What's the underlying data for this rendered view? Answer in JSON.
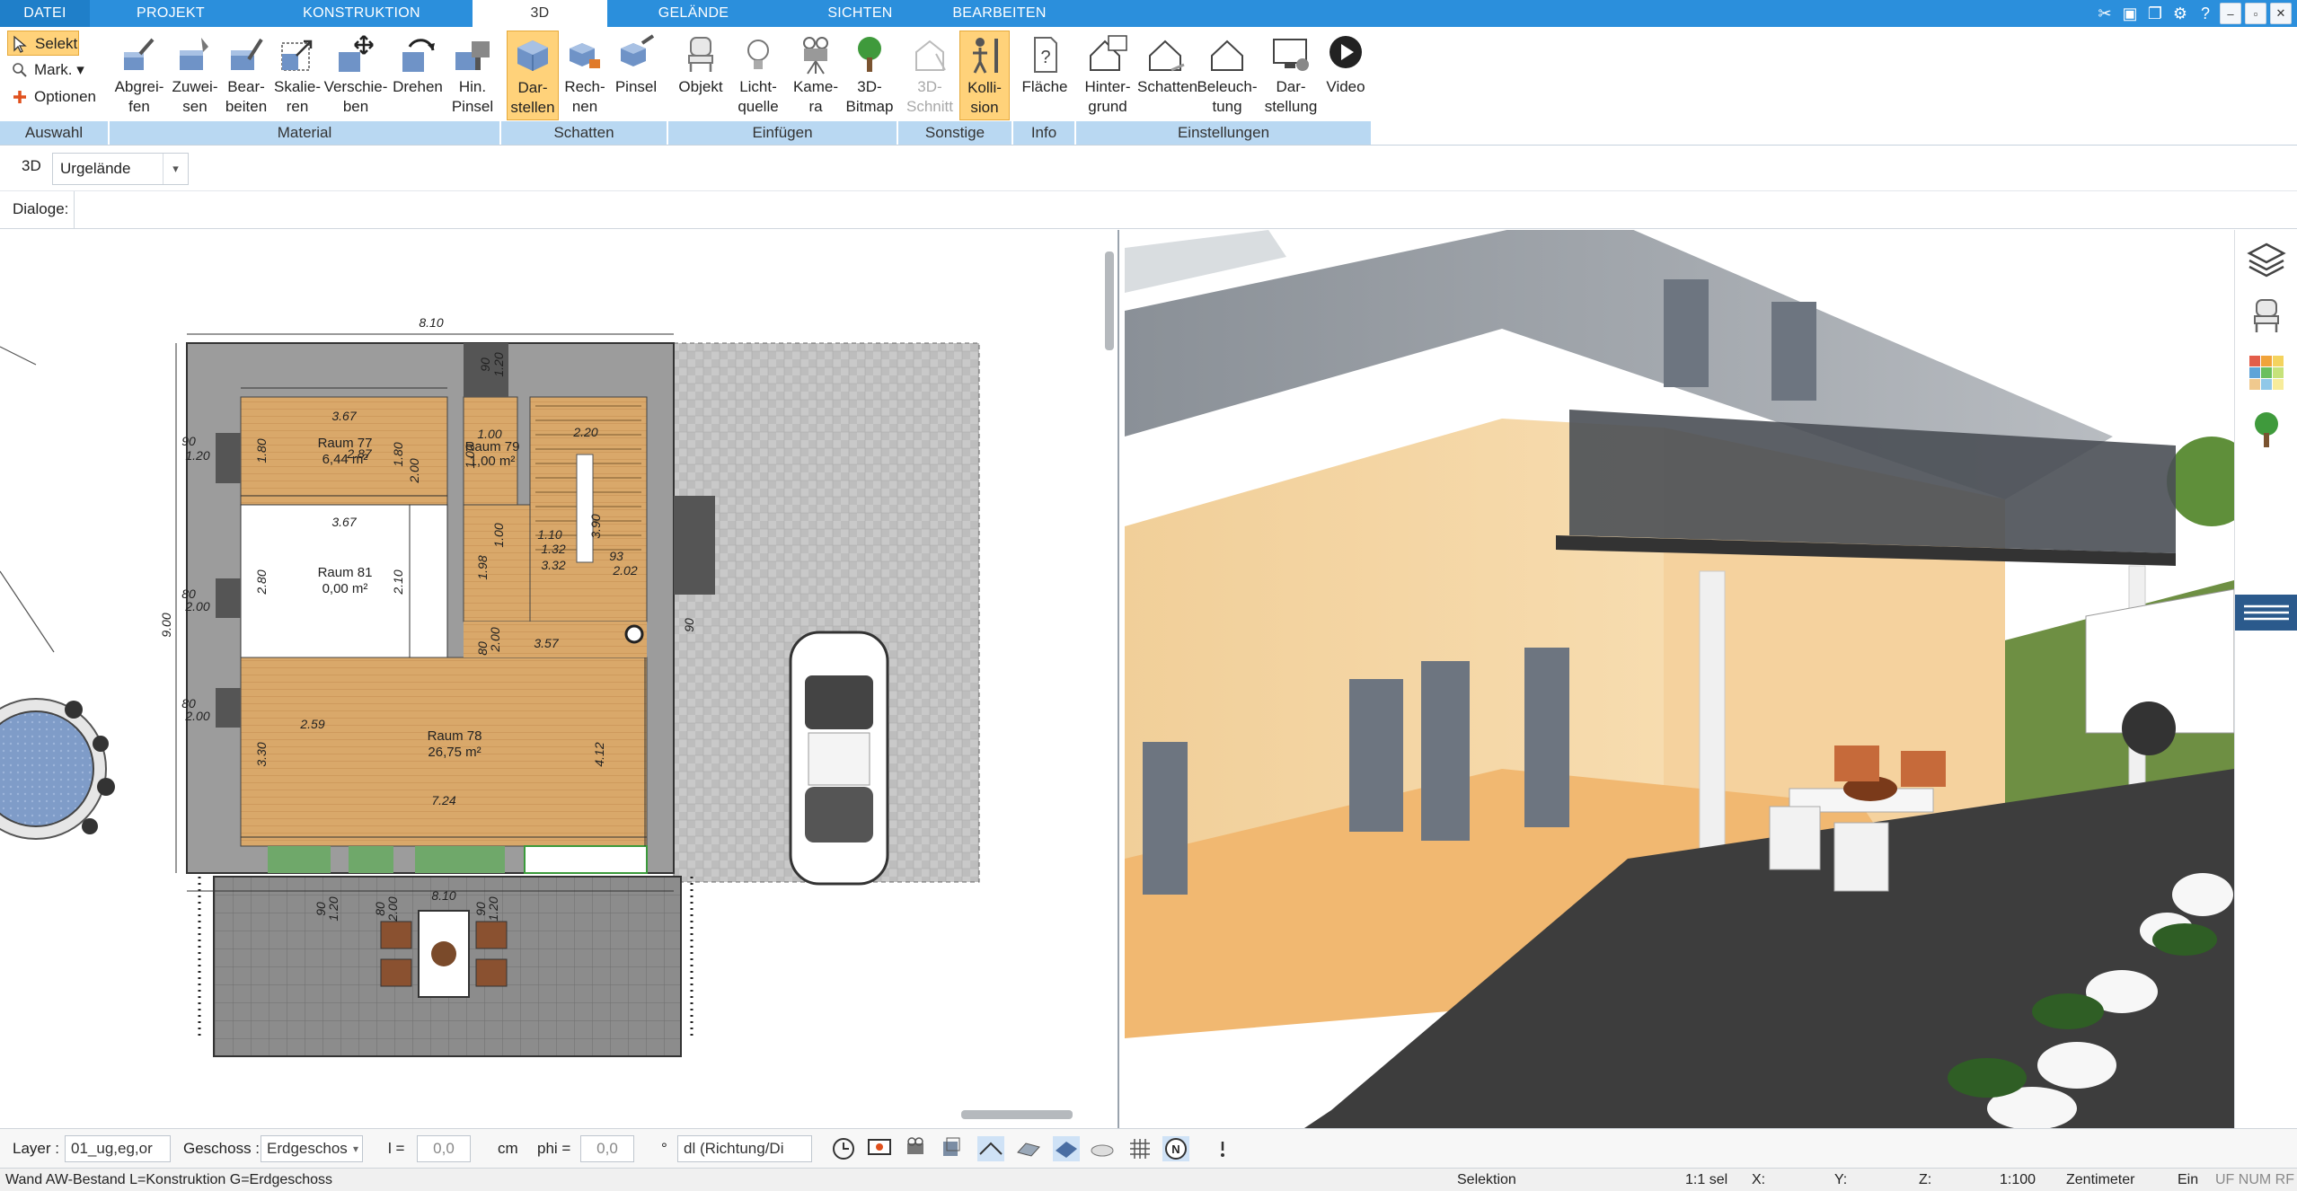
{
  "tabs": [
    "DATEI",
    "PROJEKT",
    "KONSTRUKTION",
    "3D",
    "GELÄNDE",
    "SICHTEN",
    "BEARBEITEN"
  ],
  "active_tab": "3D",
  "ribbon": {
    "auswahl": {
      "selekt": "Selekt",
      "mark": "Mark.",
      "optionen": "Optionen",
      "group": "Auswahl"
    },
    "material": {
      "group": "Material",
      "buttons": [
        "Abgrei-\nfen",
        "Zuwei-\nsen",
        "Bear-\nbeiten",
        "Skalie-\nren",
        "Verschie-\nben",
        "Drehen",
        "Hin.\nPinsel"
      ]
    },
    "schatten": {
      "group": "Schatten",
      "buttons": [
        "Dar-\nstellen",
        "Rech-\nnen",
        "Pinsel"
      ]
    },
    "einfuegen": {
      "group": "Einfügen",
      "buttons": [
        "Objekt",
        "Licht-\nquelle",
        "Kame-\nra",
        "3D-\nBitmap"
      ]
    },
    "sonstige": {
      "group": "Sonstige",
      "buttons": [
        "3D-\nSchnitt",
        "Kolli-\nsion"
      ]
    },
    "info": {
      "group": "Info",
      "buttons": [
        "Fläche"
      ]
    },
    "einstellungen": {
      "group": "Einstellungen",
      "buttons": [
        "Hinter-\ngrund",
        "Schatten",
        "Beleuch-\ntung",
        "Dar-\nstellung",
        "Video"
      ]
    }
  },
  "row3d": {
    "label": "3D",
    "terrain_value": "Urgelände"
  },
  "dialoge_label": "Dialoge:",
  "plan": {
    "dims": {
      "top_width": "8.10",
      "side_height": "9.00",
      "wall_90a": "90",
      "wall_120a": "1.20",
      "r77_w": "3.67",
      "r77_h": "1.80",
      "r77_h2": "1.80",
      "r77_d": "2.00",
      "r77_w2": "2.87",
      "r79_w": "1.00",
      "r79_h": "1.00",
      "stair_w": "2.20",
      "stair_h": "3.90",
      "stair_a": "1.32",
      "stair_b": "1.10",
      "r81_w": "3.67",
      "r81_h": "2.80",
      "r81_h2": "2.10",
      "small_a": "1.98",
      "small_b": "1.00",
      "small_c": "3.32",
      "small_d": "2.02",
      "small_e": "93",
      "left_90a": "90",
      "left_120a": "1.20",
      "left_80a": "80",
      "left_200a": "2.00",
      "left_80b": "80",
      "left_200b": "2.00",
      "door_80": "80",
      "door_200": "2.00",
      "r78_w": "3.57",
      "r78_w2": "2.59",
      "r78_h": "3.30",
      "r78_h2": "4.12",
      "r78_w3": "7.24",
      "right_90": "90",
      "bottom_width": "8.10",
      "bot_90": "90",
      "bot_120": "1.20",
      "bot_80": "80",
      "bot_200": "2.00",
      "bot_90b": "90",
      "bot_120b": "1.20",
      "r77_extra": "3.67"
    },
    "rooms": [
      {
        "name": "Raum 77",
        "area": "6,44 m²"
      },
      {
        "name": "Raum 79",
        "area": "1,00 m²"
      },
      {
        "name": "Raum 81",
        "area": "0,00 m²"
      },
      {
        "name": "Raum 78",
        "area": "26,75 m²"
      }
    ]
  },
  "bottombar": {
    "layer_label": "Layer :",
    "layer_value": "01_ug,eg,or",
    "geschoss_label": "Geschoss :",
    "geschoss_value": "Erdgeschos",
    "l_label": "l =",
    "l_value": "0,0",
    "l_unit": "cm",
    "phi_label": "phi =",
    "phi_value": "0,0",
    "phi_unit": "°",
    "dl_value": "dl (Richtung/Di"
  },
  "statusbar": {
    "left": "Wand AW-Bestand L=Konstruktion G=Erdgeschoss",
    "mode": "Selektion",
    "sel": "1:1 sel",
    "x": "X:",
    "y": "Y:",
    "z": "Z:",
    "scale": "1:100",
    "unit": "Zentimeter",
    "ein": "Ein",
    "flags": "UF NUM RF"
  },
  "colors": {
    "accent": "#2b8fdc",
    "group_band": "#b9d8f2",
    "selected": "#ffd27a",
    "floor_wood": "#d9a86a"
  }
}
